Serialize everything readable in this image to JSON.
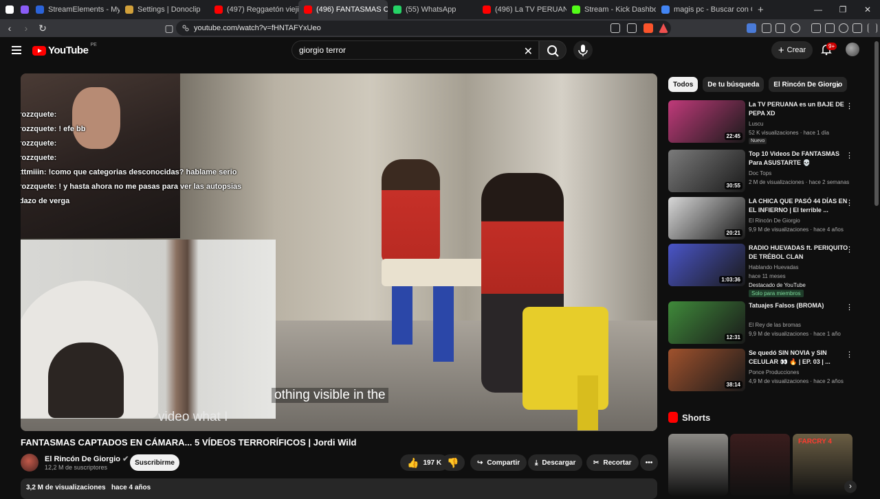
{
  "tabs": [
    {
      "label": "",
      "color": "#ffffff"
    },
    {
      "label": "",
      "color": "#8a5cf6"
    },
    {
      "label": "StreamElements - My dashboard",
      "color": "#2b63d9"
    },
    {
      "label": "Settings | Donoclip",
      "color": "#d1a03a"
    },
    {
      "label": "(497) Reggaetón viejito (para",
      "color": "#ff0000"
    },
    {
      "label": "(496) FANTASMAS CAPTAD",
      "color": "#ff0000",
      "active": true
    },
    {
      "label": "(55) WhatsApp",
      "color": "#25d366"
    },
    {
      "label": "(496) La TV PERUANA es un BAJE",
      "color": "#ff0000"
    },
    {
      "label": "Stream - Kick Dashboard",
      "color": "#53fc18"
    },
    {
      "label": "magis pc - Buscar con Google",
      "color": "#4285f4"
    }
  ],
  "url": "youtube.com/watch?v=fHNTAFYxUeo",
  "header": {
    "logo_text": "YouTube",
    "country": "PE",
    "search_query": "giorgio terror",
    "create_label": "Crear",
    "notif_count": "9+"
  },
  "chat": [
    {
      "user": "rozzquete:",
      "msg": ""
    },
    {
      "user": "rozzquete:",
      "msg": "! efe bb"
    },
    {
      "user": "rozzquete:",
      "msg": ""
    },
    {
      "user": "rozzquete:",
      "msg": ""
    },
    {
      "user": "catttmiiin:",
      "msg": "!como que categorias desconocidas? hablame serio"
    },
    {
      "user": "rozzquete:",
      "msg": "! y hasta ahora no me pasas para ver las autopsias"
    },
    {
      "user": "",
      "msg": "pedazo de verga"
    }
  ],
  "subtitle_line1": "othing visible in the",
  "subtitle_line2": "video what I",
  "video": {
    "title": "FANTASMAS CAPTADOS EN CÁMARA... 5 VÍDEOS TERRORÍFICOS | Jordi Wild",
    "channel": "El Rincón De Giorgio",
    "subscribers": "12,2 M de suscriptores",
    "subscribe_label": "Suscribirme",
    "likes": "197 K",
    "share_label": "Compartir",
    "download_label": "Descargar",
    "clip_label": "Recortar",
    "views": "3,2 M de visualizaciones",
    "age": "hace 4 años"
  },
  "chips": [
    "Todos",
    "De tu búsqueda",
    "El Rincón De Giorgio"
  ],
  "recommendations": [
    {
      "title": "La TV PERUANA es un BAJE DE PEPA XD",
      "channel": "Luscu",
      "meta": "52 K visualizaciones · hace 1 día",
      "duration": "22:45",
      "badge": "Nuevo",
      "thumb": "#c03a7a"
    },
    {
      "title": "Top 10 Videos De FANTASMAS Para ASUSTARTE 💀",
      "channel": "Doc Tops",
      "meta": "2 M de visualizaciones · hace 2 semanas",
      "duration": "30:55",
      "badge": "",
      "thumb": "#7b7b7b"
    },
    {
      "title": "LA CHICA QUE PASÓ 44 DÍAS EN EL INFIERNO | El terrible ...",
      "channel": "El Rincón De Giorgio",
      "meta": "9,9 M de visualizaciones · hace 4 años",
      "duration": "20:21",
      "badge": "",
      "thumb": "#d8d8d8"
    },
    {
      "title": "RADIO HUEVADAS ft. PERIQUITO DE TRÉBOL CLAN",
      "channel": "Hablando Huevadas",
      "meta": "hace 11 meses",
      "meta2": "Destacado de YouTube",
      "members": "Solo para miembros",
      "duration": "1:03:36",
      "badge": "",
      "thumb": "#4a55c8"
    },
    {
      "title": "Tatuajes Falsos (BROMA)",
      "channel": "El Rey de las bromas",
      "meta": "9,9 M de visualizaciones · hace 1 año",
      "duration": "12:31",
      "badge": "",
      "thumb": "#3f8a3a"
    },
    {
      "title": "Se quedó SIN NOVIA y SIN CELULAR 👀 🔥 | EP. 03 | ...",
      "channel": "Ponce Producciones",
      "meta": "4,9 M de visualizaciones · hace 2 años",
      "duration": "38:14",
      "badge": "",
      "thumb": "#a0522d"
    }
  ],
  "shorts": {
    "label": "Shorts",
    "items": [
      {
        "thumb": "#8c8a86",
        "caption": ""
      },
      {
        "thumb": "#3a1d1d",
        "caption": ""
      },
      {
        "thumb": "#6b5e44",
        "caption": "FARCRY 4"
      }
    ]
  }
}
